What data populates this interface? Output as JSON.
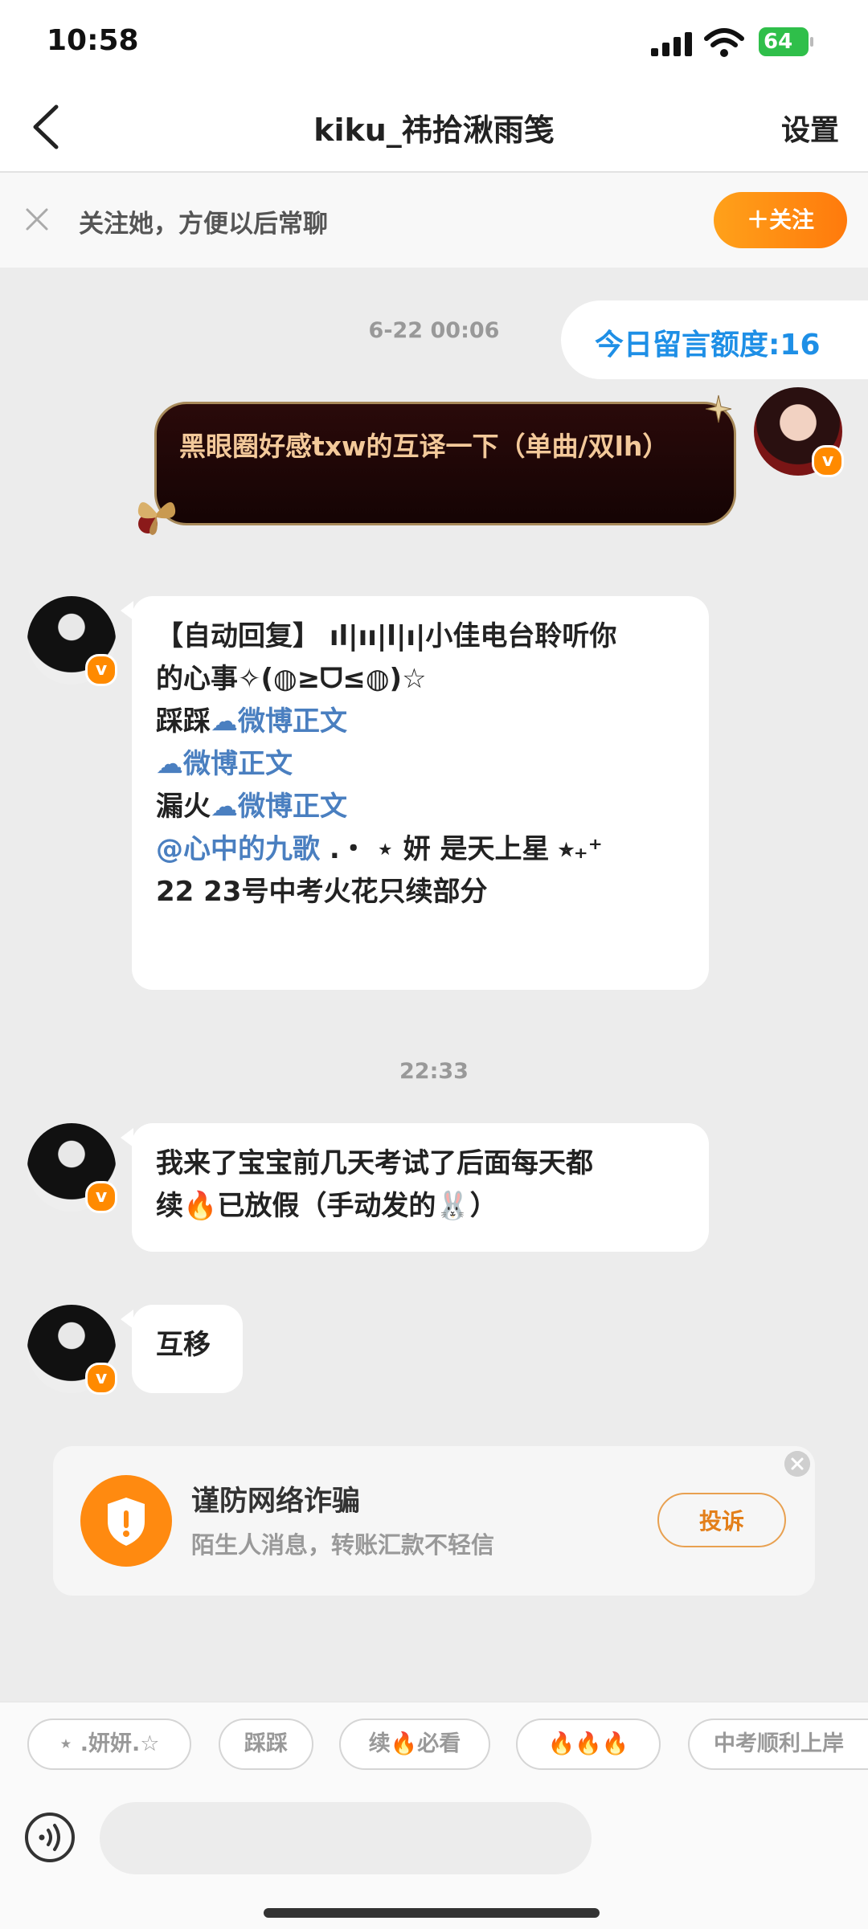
{
  "status_bar": {
    "time": "10:58",
    "battery": "64"
  },
  "header": {
    "title": "kiku_祎拾湫雨笺",
    "settings": "设置"
  },
  "follow_bar": {
    "text": "关注她，方便以后常聊",
    "button": "＋关注"
  },
  "quota": {
    "text": "今日留言额度:16"
  },
  "timestamps": [
    "6-22 00:06",
    "22:33"
  ],
  "my_message": {
    "text": "黑眼圈好感txw的互译一下（单曲/双lh）"
  },
  "auto_reply": {
    "line1": "【自动回复】 ıl|ıı|l|ı|小佳电台聆听你",
    "line2": "的心事✧(◍≥ᗜ≤◍)☆",
    "line3_prefix": "踩踩",
    "link_label": "微博正文",
    "line5_prefix": "漏火",
    "mention": "@心中的九歌",
    "line6_rest": " .・ ⋆ 妍 是天上星 ⭒₊⁺",
    "line7": "22  23号中考火花只续部分"
  },
  "msg2": {
    "text_a": "我来了宝宝前几天考试了后面每天都",
    "text_b_prefix": "续",
    "text_b_mid": "已放假（手动发的",
    "text_b_end": "）"
  },
  "msg3": {
    "text": "互移"
  },
  "fraud_card": {
    "title": "谨防网络诈骗",
    "subtitle": "陌生人消息，转账汇款不轻信",
    "button": "投诉"
  },
  "chips": [
    "⋆ .妍妍.☆",
    "踩踩",
    "续🔥必看",
    "🔥🔥🔥",
    "中考顺利上岸"
  ],
  "icons": {
    "verified": "v-badge",
    "fire": "🔥",
    "bunny": "🐰",
    "cloud": "weibo-cloud-icon"
  }
}
